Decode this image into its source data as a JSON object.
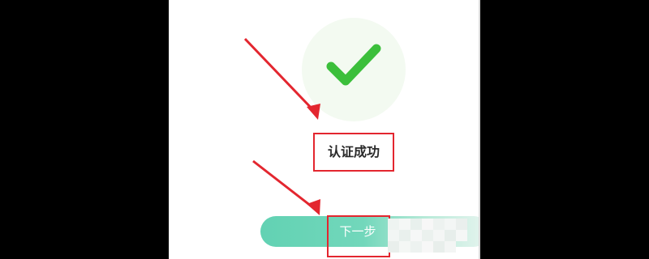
{
  "status": {
    "text": "认证成功"
  },
  "actions": {
    "next_label": "下一步"
  },
  "colors": {
    "check": "#3bbf3b",
    "annotation": "#e3262f",
    "button_start": "#62d2b3"
  },
  "icons": {
    "success": "check-icon"
  }
}
